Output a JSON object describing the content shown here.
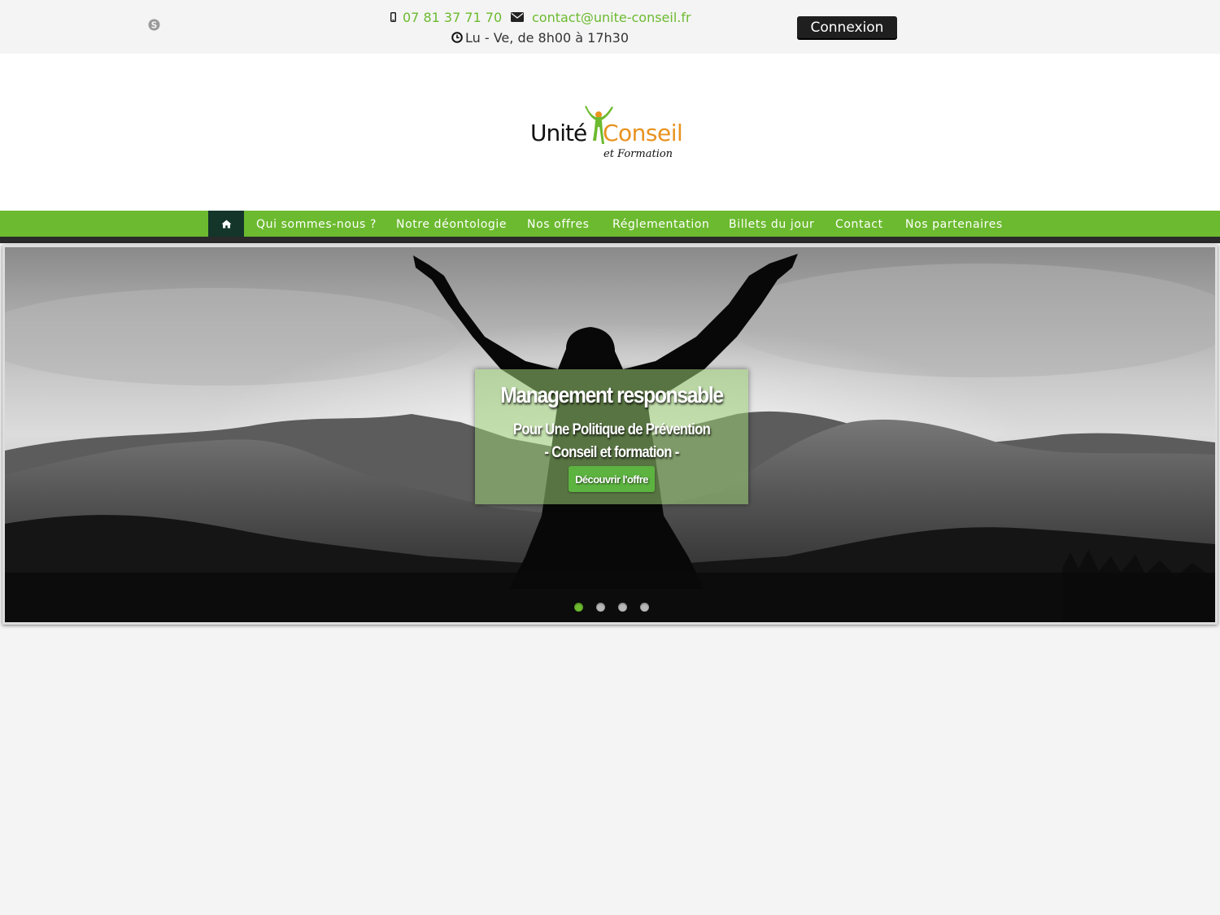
{
  "topbar": {
    "phone": "07 81 37 71 70",
    "email": "contact@unite-conseil.fr",
    "hours": "Lu - Ve, de 8h00 à 17h30",
    "login_label": "Connexion",
    "icons": [
      "skype-icon",
      "mobile-phone-icon",
      "envelope-icon",
      "clock-icon"
    ]
  },
  "logo": {
    "part1": "Unité",
    "part2": "Conseil",
    "part3": "et Formation"
  },
  "nav": {
    "home_icon": "home-icon",
    "items": [
      {
        "label": "Qui sommes-nous ?"
      },
      {
        "label": "Notre déontologie"
      },
      {
        "label": "Nos offres"
      },
      {
        "label": "Réglementation"
      },
      {
        "label": "Billets du jour"
      },
      {
        "label": "Contact"
      },
      {
        "label": "Nos partenaires"
      }
    ]
  },
  "slider": {
    "title": "Management responsable",
    "subtitle_line1": "Pour Une Politique de Prévention",
    "subtitle_line2": "- Conseil et formation -",
    "button_label": "Découvrir l'offre",
    "slide_count": 4,
    "active_slide": 1
  },
  "colors": {
    "brand_green": "#6cba2f",
    "brand_orange": "#e8921e",
    "nav_home_bg": "#13352a",
    "login_bg": "#1f1f1f",
    "page_bg": "#f4f4f4"
  }
}
